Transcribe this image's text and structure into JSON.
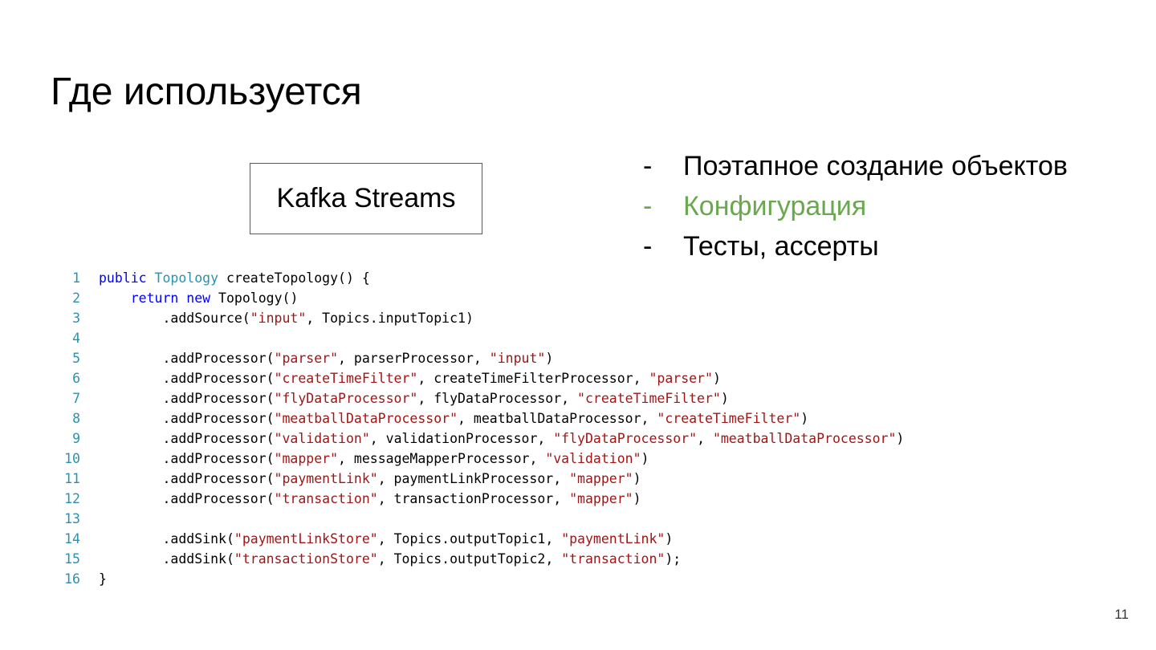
{
  "slide": {
    "title": "Где используется",
    "box_label": "Kafka Streams",
    "page_number": "11"
  },
  "bullets": [
    {
      "dash": "-",
      "text": "Поэтапное создание объектов",
      "highlight": false
    },
    {
      "dash": "-",
      "text": "Конфигурация",
      "highlight": true
    },
    {
      "dash": "-",
      "text": "Тесты, ассерты",
      "highlight": false
    }
  ],
  "colors": {
    "highlight_bullet": "#6aa84f",
    "code_keyword": "#0000ff",
    "code_type": "#2b91af",
    "code_string": "#a31515",
    "line_number": "#2b91af"
  },
  "code": {
    "lines": [
      {
        "num": "1",
        "tokens": [
          {
            "t": "kw",
            "v": "public"
          },
          {
            "t": "tx",
            "v": " "
          },
          {
            "t": "ty",
            "v": "Topology"
          },
          {
            "t": "tx",
            "v": " createTopology() {"
          }
        ]
      },
      {
        "num": "2",
        "tokens": [
          {
            "t": "tx",
            "v": "    "
          },
          {
            "t": "kw",
            "v": "return"
          },
          {
            "t": "tx",
            "v": " "
          },
          {
            "t": "kw",
            "v": "new"
          },
          {
            "t": "tx",
            "v": " Topology()"
          }
        ]
      },
      {
        "num": "3",
        "tokens": [
          {
            "t": "tx",
            "v": "        .addSource("
          },
          {
            "t": "st",
            "v": "\"input\""
          },
          {
            "t": "tx",
            "v": ", Topics.inputTopic1)"
          }
        ]
      },
      {
        "num": "4",
        "tokens": []
      },
      {
        "num": "5",
        "tokens": [
          {
            "t": "tx",
            "v": "        .addProcessor("
          },
          {
            "t": "st",
            "v": "\"parser\""
          },
          {
            "t": "tx",
            "v": ", parserProcessor, "
          },
          {
            "t": "st",
            "v": "\"input\""
          },
          {
            "t": "tx",
            "v": ")"
          }
        ]
      },
      {
        "num": "6",
        "tokens": [
          {
            "t": "tx",
            "v": "        .addProcessor("
          },
          {
            "t": "st",
            "v": "\"createTimeFilter\""
          },
          {
            "t": "tx",
            "v": ", createTimeFilterProcessor, "
          },
          {
            "t": "st",
            "v": "\"parser\""
          },
          {
            "t": "tx",
            "v": ")"
          }
        ]
      },
      {
        "num": "7",
        "tokens": [
          {
            "t": "tx",
            "v": "        .addProcessor("
          },
          {
            "t": "st",
            "v": "\"flyDataProcessor\""
          },
          {
            "t": "tx",
            "v": ", flyDataProcessor, "
          },
          {
            "t": "st",
            "v": "\"createTimeFilter\""
          },
          {
            "t": "tx",
            "v": ")"
          }
        ]
      },
      {
        "num": "8",
        "tokens": [
          {
            "t": "tx",
            "v": "        .addProcessor("
          },
          {
            "t": "st",
            "v": "\"meatballDataProcessor\""
          },
          {
            "t": "tx",
            "v": ", meatballDataProcessor, "
          },
          {
            "t": "st",
            "v": "\"createTimeFilter\""
          },
          {
            "t": "tx",
            "v": ")"
          }
        ]
      },
      {
        "num": "9",
        "tokens": [
          {
            "t": "tx",
            "v": "        .addProcessor("
          },
          {
            "t": "st",
            "v": "\"validation\""
          },
          {
            "t": "tx",
            "v": ", validationProcessor, "
          },
          {
            "t": "st",
            "v": "\"flyDataProcessor\""
          },
          {
            "t": "tx",
            "v": ", "
          },
          {
            "t": "st",
            "v": "\"meatballDataProcessor\""
          },
          {
            "t": "tx",
            "v": ")"
          }
        ]
      },
      {
        "num": "10",
        "tokens": [
          {
            "t": "tx",
            "v": "        .addProcessor("
          },
          {
            "t": "st",
            "v": "\"mapper\""
          },
          {
            "t": "tx",
            "v": ", messageMapperProcessor, "
          },
          {
            "t": "st",
            "v": "\"validation\""
          },
          {
            "t": "tx",
            "v": ")"
          }
        ]
      },
      {
        "num": "11",
        "tokens": [
          {
            "t": "tx",
            "v": "        .addProcessor("
          },
          {
            "t": "st",
            "v": "\"paymentLink\""
          },
          {
            "t": "tx",
            "v": ", paymentLinkProcessor, "
          },
          {
            "t": "st",
            "v": "\"mapper\""
          },
          {
            "t": "tx",
            "v": ")"
          }
        ]
      },
      {
        "num": "12",
        "tokens": [
          {
            "t": "tx",
            "v": "        .addProcessor("
          },
          {
            "t": "st",
            "v": "\"transaction\""
          },
          {
            "t": "tx",
            "v": ", transactionProcessor, "
          },
          {
            "t": "st",
            "v": "\"mapper\""
          },
          {
            "t": "tx",
            "v": ")"
          }
        ]
      },
      {
        "num": "13",
        "tokens": []
      },
      {
        "num": "14",
        "tokens": [
          {
            "t": "tx",
            "v": "        .addSink("
          },
          {
            "t": "st",
            "v": "\"paymentLinkStore\""
          },
          {
            "t": "tx",
            "v": ", Topics.outputTopic1, "
          },
          {
            "t": "st",
            "v": "\"paymentLink\""
          },
          {
            "t": "tx",
            "v": ")"
          }
        ]
      },
      {
        "num": "15",
        "tokens": [
          {
            "t": "tx",
            "v": "        .addSink("
          },
          {
            "t": "st",
            "v": "\"transactionStore\""
          },
          {
            "t": "tx",
            "v": ", Topics.outputTopic2, "
          },
          {
            "t": "st",
            "v": "\"transaction\""
          },
          {
            "t": "tx",
            "v": ");"
          }
        ]
      },
      {
        "num": "16",
        "tokens": [
          {
            "t": "tx",
            "v": "}"
          }
        ]
      }
    ]
  }
}
